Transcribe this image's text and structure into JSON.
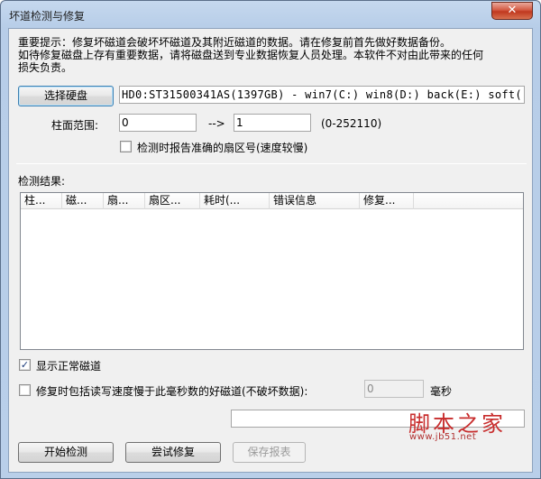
{
  "window": {
    "title": "坏道检测与修复",
    "close_label": "✕"
  },
  "notice": {
    "line1": "重要提示：修复坏磁道会破坏坏磁道及其附近磁道的数据。请在修复前首先做好数据备份。",
    "line2": "如待修复磁盘上存有重要数据，请将磁盘送到专业数据恢复人员处理。本软件不对由此带来的任何",
    "line3": "损失负责。"
  },
  "disk": {
    "select_label": "选择硬盘",
    "info": "HD0:ST31500341AS(1397GB) - win7(C:) win8(D:) back(E:) soft("
  },
  "cylinder": {
    "label": "柱面范围:",
    "from": "0",
    "arrow": "-->",
    "to": "1",
    "range_hint": "(0-252110)"
  },
  "options": {
    "accurate_sector": {
      "label": "检测时报告准确的扇区号(速度较慢)",
      "checked": false
    },
    "show_normal": {
      "label": "显示正常磁道",
      "checked": true
    },
    "include_slow": {
      "label": "修复时包括读写速度慢于此毫秒数的好磁道(不破坏数据):",
      "checked": false,
      "value": "0",
      "unit": "毫秒"
    }
  },
  "results": {
    "label": "检测结果:",
    "columns": [
      "柱...",
      "磁...",
      "扇...",
      "扇区...",
      "耗时(...",
      "错误信息",
      "修复..."
    ]
  },
  "status_text": "",
  "buttons": {
    "start": "开始检测",
    "repair": "尝试修复",
    "save": "保存报表"
  },
  "watermark": {
    "main": "脚本之家",
    "url": "www.jb51.net"
  }
}
